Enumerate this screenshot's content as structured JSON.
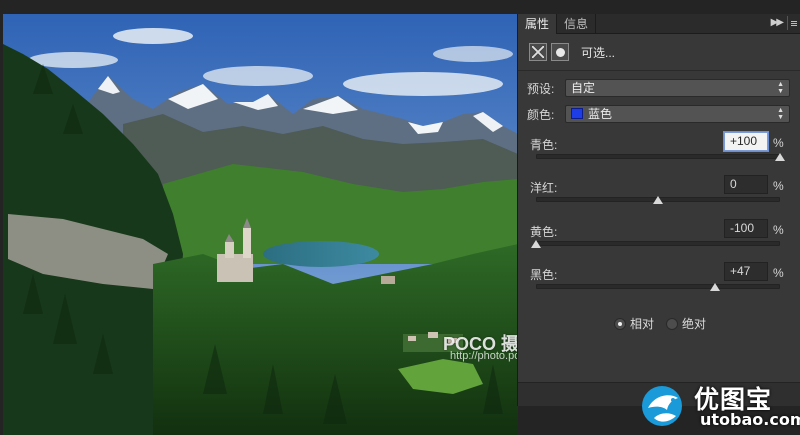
{
  "panel": {
    "tabs": [
      {
        "label": "属性"
      },
      {
        "label": "信息"
      }
    ],
    "adjustment_title": "可选...",
    "preset": {
      "label": "预设:",
      "value": "自定"
    },
    "colors": {
      "label": "颜色:",
      "value": "蓝色",
      "swatch": "#1f3de6"
    },
    "sliders": [
      {
        "label": "青色:",
        "value": "+100",
        "percent": 100,
        "unit": "%"
      },
      {
        "label": "洋红:",
        "value": "0",
        "percent": 0,
        "unit": "%"
      },
      {
        "label": "黄色:",
        "value": "-100",
        "percent": -100,
        "unit": "%"
      },
      {
        "label": "黑色:",
        "value": "+47",
        "percent": 47,
        "unit": "%"
      }
    ],
    "method": {
      "options": [
        {
          "label": "相对",
          "selected": true
        },
        {
          "label": "绝对",
          "selected": false
        }
      ]
    }
  },
  "photo": {
    "watermark": "POCO 摄影专题",
    "watermark_url": "http://photo.poco.cn/"
  },
  "logo": {
    "name": "优图宝",
    "url": "utobao.com"
  },
  "colors": {
    "panel_bg": "#383838",
    "accent_blue": "#1f3de6",
    "logo_blue": "#1a9ad8"
  }
}
